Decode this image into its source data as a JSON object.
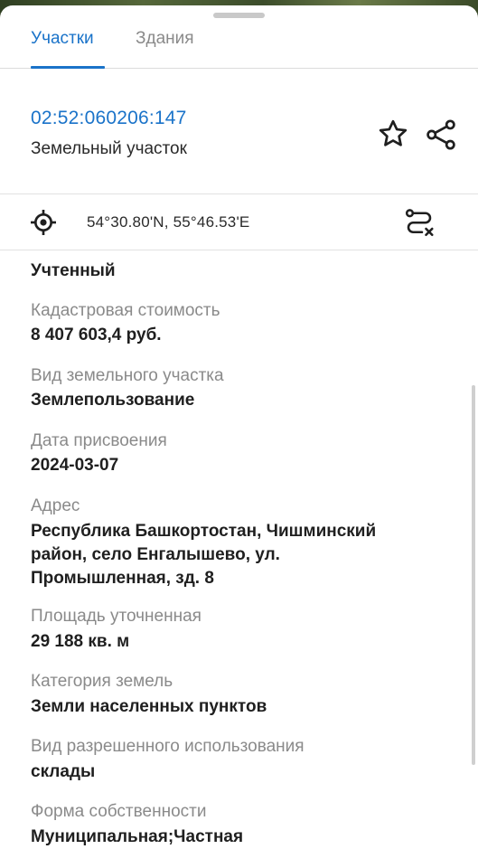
{
  "tabs": [
    {
      "label": "Участки",
      "active": true
    },
    {
      "label": "Здания",
      "active": false
    }
  ],
  "parcel": {
    "cadastral_number": "02:52:060206:147",
    "object_type": "Земельный участок"
  },
  "location": {
    "coordinates": "54°30.80'N, 55°46.53'E"
  },
  "status": "Учтенный",
  "fields": [
    {
      "label": "Кадастровая стоимость",
      "value": "8 407 603,4 руб."
    },
    {
      "label": "Вид земельного участка",
      "value": "Землепользование"
    },
    {
      "label": "Дата присвоения",
      "value": "2024-03-07"
    },
    {
      "label": "Адрес",
      "value_lines": [
        "Республика Башкортостан, Чишминский",
        "район, село Енгалышево, ул.",
        "Промышленная, зд. 8"
      ]
    },
    {
      "label": "Площадь уточненная",
      "value": "29 188 кв. м"
    },
    {
      "label": "Категория земель",
      "value": "Земли населенных пунктов"
    },
    {
      "label": "Вид разрешенного использования",
      "value": "склады"
    },
    {
      "label": "Форма собственности",
      "value": "Муниципальная;Частная"
    }
  ],
  "colors": {
    "accent": "#1a73c9",
    "label": "#8a8a8a",
    "value": "#1f1f1f"
  },
  "icons": [
    "star-icon",
    "share-icon",
    "locate-icon",
    "route-icon"
  ]
}
